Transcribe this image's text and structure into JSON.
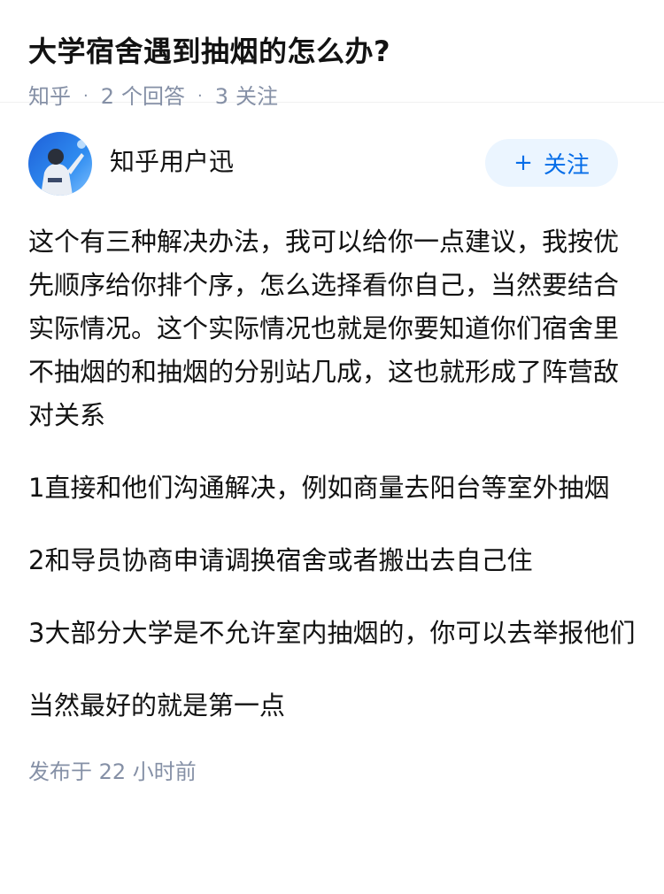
{
  "question": {
    "title": "大学宿舍遇到抽烟的怎么办?",
    "source": "知乎",
    "answer_count": "2",
    "answer_label": "个回答",
    "follow_count": "3",
    "follow_label": "关注"
  },
  "answer": {
    "author": {
      "name": "知乎用户迅",
      "avatar_icon": "avatar-icon"
    },
    "follow_button": {
      "plus": "+",
      "label": "关注"
    },
    "paragraphs": [
      "这个有三种解决办法，我可以给你一点建议，我按优先顺序给你排个序，怎么选择看你自己，当然要结合实际情况。这个实际情况也就是你要知道你们宿舍里不抽烟的和抽烟的分别站几成，这也就形成了阵营敌对关系",
      "1直接和他们沟通解决，例如商量去阳台等室外抽烟",
      "2和导员协商申请调换宿舍或者搬出去自己住",
      "3大部分大学是不允许室内抽烟的，你可以去举报他们",
      "当然最好的就是第一点"
    ],
    "published": "发布于  22 小时前"
  },
  "colors": {
    "text": "#121212",
    "meta": "#8590a6",
    "accent": "#056de8",
    "button_bg": "#ebf5ff"
  }
}
